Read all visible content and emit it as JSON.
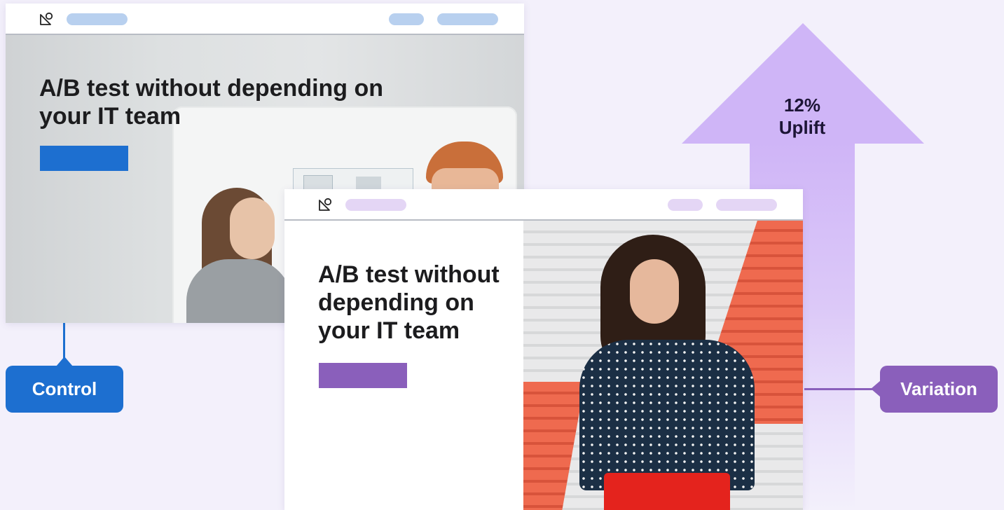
{
  "uplift": {
    "line1": "12%",
    "line2": "Uplift"
  },
  "control": {
    "label": "Control",
    "headline": "A/B test without depending on your IT team",
    "accent_color": "#1d6fd0",
    "nav_pill_color": "#b8d0ef"
  },
  "variation": {
    "label": "Variation",
    "headline": "A/B test without depending on your IT team",
    "accent_color": "#8a5fbb",
    "nav_pill_color": "#e4d6f5"
  },
  "icons": {
    "logo": "logo-icon"
  }
}
